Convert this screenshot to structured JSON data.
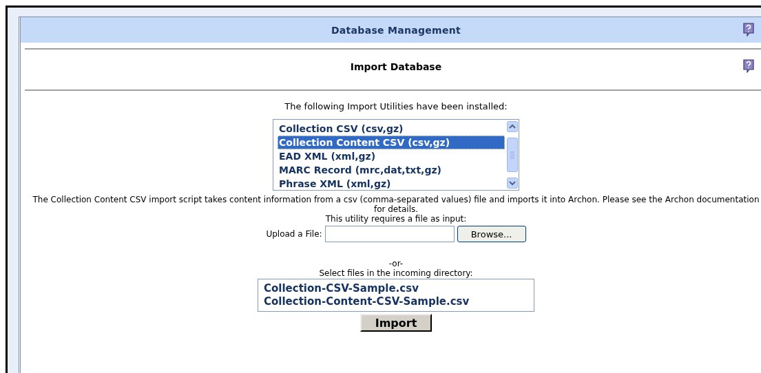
{
  "header": {
    "title": "Database Management"
  },
  "section": {
    "title": "Import Database"
  },
  "intro": "The following Import Utilities have been installed:",
  "utilities": [
    {
      "label": "Collection CSV (csv,gz)",
      "selected": false
    },
    {
      "label": "Collection Content CSV (csv,gz)",
      "selected": true
    },
    {
      "label": "EAD XML (xml,gz)",
      "selected": false
    },
    {
      "label": "MARC Record (mrc,dat,txt,gz)",
      "selected": false
    },
    {
      "label": "Phrase XML (xml,gz)",
      "selected": false
    }
  ],
  "description": "The Collection Content CSV import script takes content information from a csv (comma-separated values) file and imports it into Archon. Please see the Archon documentation for details.",
  "requirement": "This utility requires a file as input:",
  "upload": {
    "label": "Upload a File:",
    "button": "Browse..."
  },
  "separator": "-or-",
  "incoming": {
    "label": "Select files in the incoming directory:",
    "files": [
      {
        "label": "Collection-CSV-Sample.csv",
        "selected": false
      },
      {
        "label": "Collection-Content-CSV-Sample.csv",
        "selected": false
      }
    ]
  },
  "import_button": "Import"
}
